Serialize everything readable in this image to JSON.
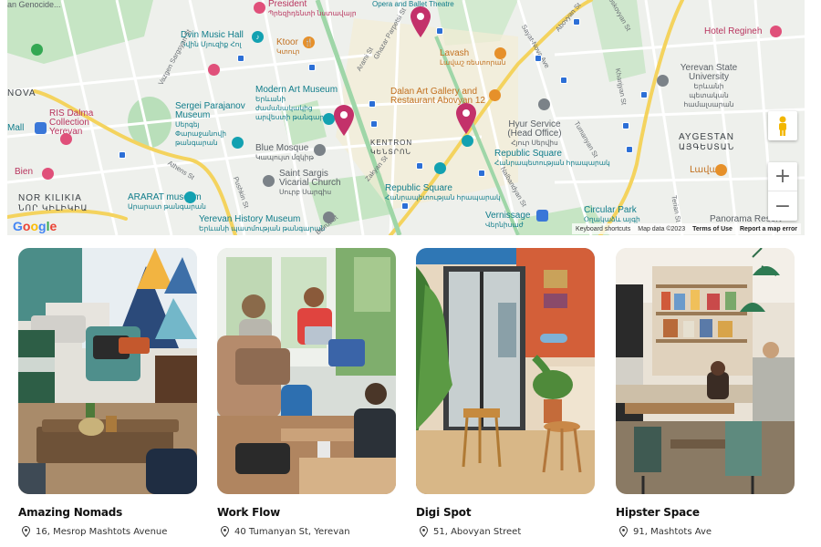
{
  "map": {
    "labels": {
      "genocide": "an Genocide...",
      "president": "President",
      "president_sub": "Պրեզիդենտի նստավայր",
      "opera": "Opera and Ballet Theatre",
      "dvin": "Dvin Music Hall",
      "dvin_sub": "Դվին Մյուզիք Հոլ",
      "ktoor": "Ktoor",
      "ktoor_sub": "Կտուր",
      "lavash": "Lavash",
      "lavash_sub": "Լավաշ ռեստորան",
      "hotel_regineh": "Hotel Regineh",
      "ysu": "Yerevan State University",
      "ysu_sub": "Երևանի պետական համալսարան",
      "modern_art": "Modern Art Museum",
      "modern_art_sub": "Երևանի ժամանակակից արվեստի թանգարան",
      "dalan": "Dalan Art Gallery and Restaurant Abovyan 12",
      "ris_dalma": "RIS Dalma Collection Yerevan",
      "parajanov": "Sergei Parajanov Museum",
      "parajanov_sub": "Սերգեյ Փարաջանովի թանգարան",
      "hyur": "Hyur Service (Head Office)",
      "hyur_sub": "Հյուր Սերվիս",
      "aygestan": "AYGESTAN",
      "aygestan_sub": "ԱՅԳԵՍՏԱՆ",
      "mall": "Mall",
      "kentron": "KENTRON",
      "kentron_sub": "ԿԵՆՏՐՈՆ",
      "blue_mosque": "Blue Mosque",
      "blue_mosque_sub": "Կապույտ մզկիթ",
      "republic_sq_1": "Republic Square",
      "republic_sq_1_sub": "Հանրապետության հրապարակ",
      "lavash_2": "Լավաշ",
      "bien": "Bien",
      "saint_sargis": "Saint Sargis Vicarial Church",
      "saint_sargis_sub": "Սուրբ Սարգիս",
      "republic_sq_2": "Republic Square",
      "republic_sq_2_sub": "Հանրապետության հրապարակ",
      "nor_kilikia": "NOR KILIKIA",
      "nor_kilikia_sub": "ՆՈՐ ԿԻԼԻԿԻԱ",
      "ararat": "ARARAT museum",
      "ararat_sub": "Արարատ թանգարան",
      "vernissage": "Vernissage",
      "vernissage_sub": "Վերնիսաժ",
      "circular_park": "Circular Park",
      "circular_park_sub": "Օղակաձև այգի",
      "history_museum": "Yerevan History Museum",
      "history_museum_sub": "Երևանի պատմության թանգարան",
      "panorama": "Panorama Resort",
      "nova": "NOVA",
      "athens_st": "Athens St",
      "sayat_nova": "Sayat-Nova Ave",
      "tumanyan_st": "Tumanyan St",
      "abovyan_st": "Abovyan St",
      "zakyan_st": "Zakyan St",
      "beirut_st": "Beirut St",
      "arami_st": "Arami St",
      "nalbandyan_st": "Nalbandyan St",
      "pushkin_st": "Pushkin St",
      "khanjyan_st": "Khanjyan St",
      "parpetsi": "Ghazar Parpetsi St",
      "vazgen_sargsyan": "Vazgen Sargsyan St",
      "moskovyan": "Moskovyan St",
      "terian_st": "Terian St"
    },
    "google": "Google",
    "attribution": {
      "shortcuts": "Keyboard shortcuts",
      "data": "Map data ©2023",
      "terms": "Terms of Use",
      "report": "Report a map error"
    },
    "zoom_in": "+",
    "zoom_out": "−"
  },
  "cards": [
    {
      "name": "Amazing Nomads",
      "address": "16, Mesrop Mashtots Avenue"
    },
    {
      "name": "Work Flow",
      "address": "40 Tumanyan St, Yerevan"
    },
    {
      "name": "Digi Spot",
      "address": "51, Abovyan Street"
    },
    {
      "name": "Hipster Space",
      "address": "91, Mashtots Ave"
    }
  ],
  "colors": {
    "pin": "#c3316a",
    "map_bg": "#eef0ec",
    "road_yellow": "#f4d35e",
    "park_green": "#b9dfba"
  },
  "icons": [
    "pin-icon",
    "location-icon",
    "pegman-icon"
  ]
}
